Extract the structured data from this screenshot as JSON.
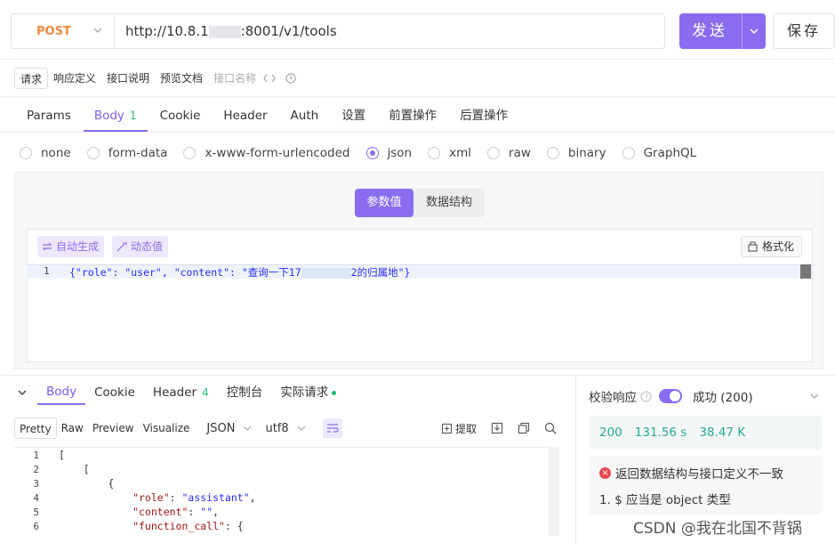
{
  "request": {
    "method": "POST",
    "url_prefix": "http://10.8.1",
    "url_suffix": ":8001/v1/tools",
    "send_label": "发送",
    "save_label": "保存"
  },
  "subtabs": [
    "请求",
    "响应定义",
    "接口说明",
    "预览文档"
  ],
  "name_placeholder": "接口名称",
  "req_tabs": [
    {
      "label": "Params"
    },
    {
      "label": "Body",
      "badge": "1"
    },
    {
      "label": "Cookie"
    },
    {
      "label": "Header"
    },
    {
      "label": "Auth"
    },
    {
      "label": "设置"
    },
    {
      "label": "前置操作"
    },
    {
      "label": "后置操作"
    }
  ],
  "body_types": [
    "none",
    "form-data",
    "x-www-form-urlencoded",
    "json",
    "xml",
    "raw",
    "binary",
    "GraphQL"
  ],
  "selected_body_type": "json",
  "segment": {
    "active": "参数值",
    "other": "数据结构"
  },
  "editor": {
    "auto_gen": "自动生成",
    "dynamic": "动态值",
    "format": "格式化",
    "line_no": "1",
    "code_prefix": "{\"role\": \"user\", \"content\": \"查询一下17",
    "code_suffix": "2的归属地\"}"
  },
  "resp_tabs": [
    {
      "label": "Body"
    },
    {
      "label": "Cookie"
    },
    {
      "label": "Header",
      "badge": "4"
    },
    {
      "label": "控制台"
    },
    {
      "label": "实际请求"
    }
  ],
  "resp_views": [
    "Pretty",
    "Raw",
    "Preview",
    "Visualize"
  ],
  "resp_format": "JSON",
  "resp_encoding": "utf8",
  "extract_label": "提取",
  "resp_lines": [
    {
      "n": "1",
      "t": "["
    },
    {
      "n": "2",
      "t": "    ["
    },
    {
      "n": "3",
      "t": "        {"
    },
    {
      "n": "4",
      "k": "            \"role\"",
      "v": "\"assistant\"",
      "e": ","
    },
    {
      "n": "5",
      "k": "            \"content\"",
      "v": "\"\"",
      "e": ","
    },
    {
      "n": "6",
      "k": "            \"function_call\"",
      "v": "{",
      "e": ""
    }
  ],
  "validate": {
    "label": "校验响应",
    "status": "成功 (200)",
    "code": "200",
    "time": "131.56 s",
    "size": "38.47 K",
    "error_title": "返回数据结构与接口定义不一致",
    "error_item": "1. $ 应当是 object 类型"
  },
  "watermark": "CSDN @我在北国不背锅",
  "colors": {
    "accent": "#8a6cf0",
    "success": "#2aa89a",
    "error": "#e8474e",
    "method": "#f0883a"
  }
}
